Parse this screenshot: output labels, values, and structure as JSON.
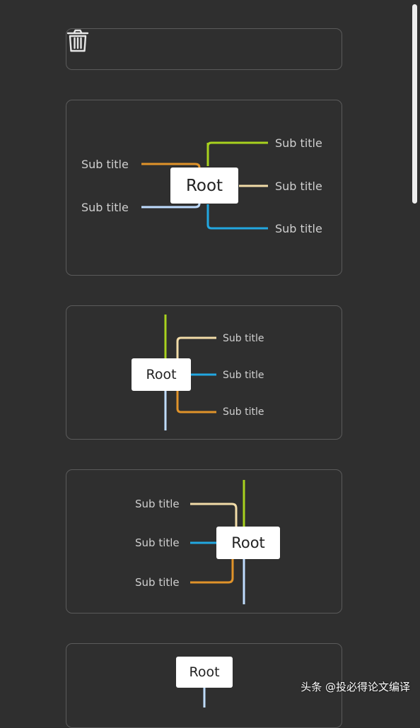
{
  "colors": {
    "background": "#2f2f2f",
    "card_border": "#5b5b5b",
    "lime": "#a8d21e",
    "orange": "#e0932a",
    "cream": "#f2dca8",
    "blue": "#22a7e0",
    "light_blue": "#bfdcff"
  },
  "toolbar": {
    "delete_icon": "trash-icon"
  },
  "layouts": [
    {
      "root": "Root",
      "subs": [
        "Sub title",
        "Sub title",
        "Sub title",
        "Sub title",
        "Sub title"
      ]
    },
    {
      "root": "Root",
      "subs": [
        "Sub title",
        "Sub title",
        "Sub title"
      ]
    },
    {
      "root": "Root",
      "subs": [
        "Sub title",
        "Sub title",
        "Sub title"
      ]
    },
    {
      "root": "Root"
    }
  ],
  "watermark": "头条 @投必得论文编译"
}
